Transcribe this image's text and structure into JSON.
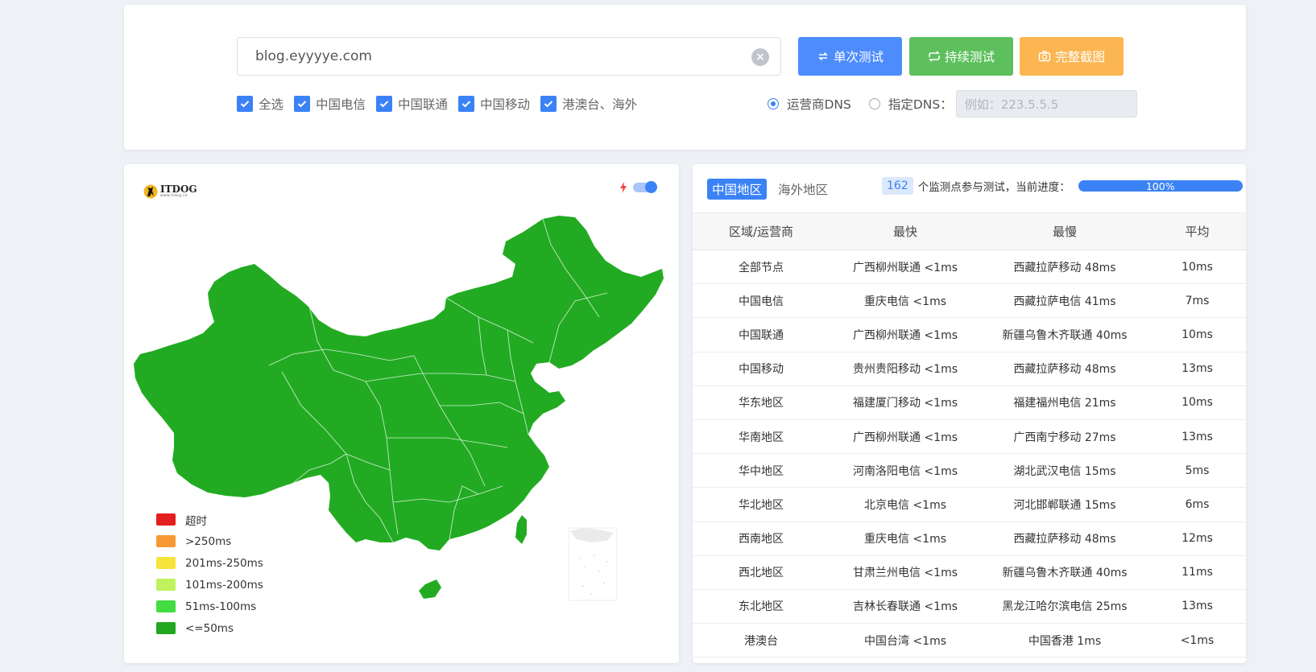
{
  "search": {
    "url_value": "blog.eyyyye.com",
    "buttons": {
      "single": "单次测试",
      "continuous": "持续测试",
      "screenshot": "完整截图"
    }
  },
  "filters": {
    "checkboxes": [
      {
        "label": "全选",
        "checked": true
      },
      {
        "label": "中国电信",
        "checked": true
      },
      {
        "label": "中国联通",
        "checked": true
      },
      {
        "label": "中国移动",
        "checked": true
      },
      {
        "label": "港澳台、海外",
        "checked": true
      }
    ],
    "dns": {
      "option_isp": "运营商DNS",
      "option_custom": "指定DNS：",
      "selected": "运营商DNS",
      "custom_placeholder": "例如：223.5.5.5"
    }
  },
  "map": {
    "logo_text": "ITDOG",
    "logo_sub": "www.itdog.cn",
    "fill_color": "#22ab22",
    "legend": [
      {
        "label": "超时",
        "color": "#e41f1f"
      },
      {
        "label": ">250ms",
        "color": "#f79a35"
      },
      {
        "label": "201ms-250ms",
        "color": "#f7e33c"
      },
      {
        "label": "101ms-200ms",
        "color": "#bff25c"
      },
      {
        "label": "51ms-100ms",
        "color": "#43dc43"
      },
      {
        "label": "<=50ms",
        "color": "#22a722"
      }
    ]
  },
  "results": {
    "tabs": [
      "中国地区",
      "海外地区"
    ],
    "active_tab": "中国地区",
    "node_count": "162",
    "progress_text": "个监测点参与测试，当前进度：",
    "progress": "100%",
    "columns": [
      "区域/运营商",
      "最快",
      "最慢",
      "平均"
    ],
    "rows": [
      [
        "全部节点",
        "广西柳州联通 <1ms",
        "西藏拉萨移动 48ms",
        "10ms"
      ],
      [
        "中国电信",
        "重庆电信 <1ms",
        "西藏拉萨电信 41ms",
        "7ms"
      ],
      [
        "中国联通",
        "广西柳州联通 <1ms",
        "新疆乌鲁木齐联通 40ms",
        "10ms"
      ],
      [
        "中国移动",
        "贵州贵阳移动 <1ms",
        "西藏拉萨移动 48ms",
        "13ms"
      ],
      [
        "华东地区",
        "福建厦门移动 <1ms",
        "福建福州电信 21ms",
        "10ms"
      ],
      [
        "华南地区",
        "广西柳州联通 <1ms",
        "广西南宁移动 27ms",
        "13ms"
      ],
      [
        "华中地区",
        "河南洛阳电信 <1ms",
        "湖北武汉电信 15ms",
        "5ms"
      ],
      [
        "华北地区",
        "北京电信 <1ms",
        "河北邯郸联通 15ms",
        "6ms"
      ],
      [
        "西南地区",
        "重庆电信 <1ms",
        "西藏拉萨移动 48ms",
        "12ms"
      ],
      [
        "西北地区",
        "甘肃兰州电信 <1ms",
        "新疆乌鲁木齐联通 40ms",
        "11ms"
      ],
      [
        "东北地区",
        "吉林长春联通 <1ms",
        "黑龙江哈尔滨电信 25ms",
        "13ms"
      ],
      [
        "港澳台",
        "中国台湾 <1ms",
        "中国香港 1ms",
        "<1ms"
      ]
    ]
  }
}
